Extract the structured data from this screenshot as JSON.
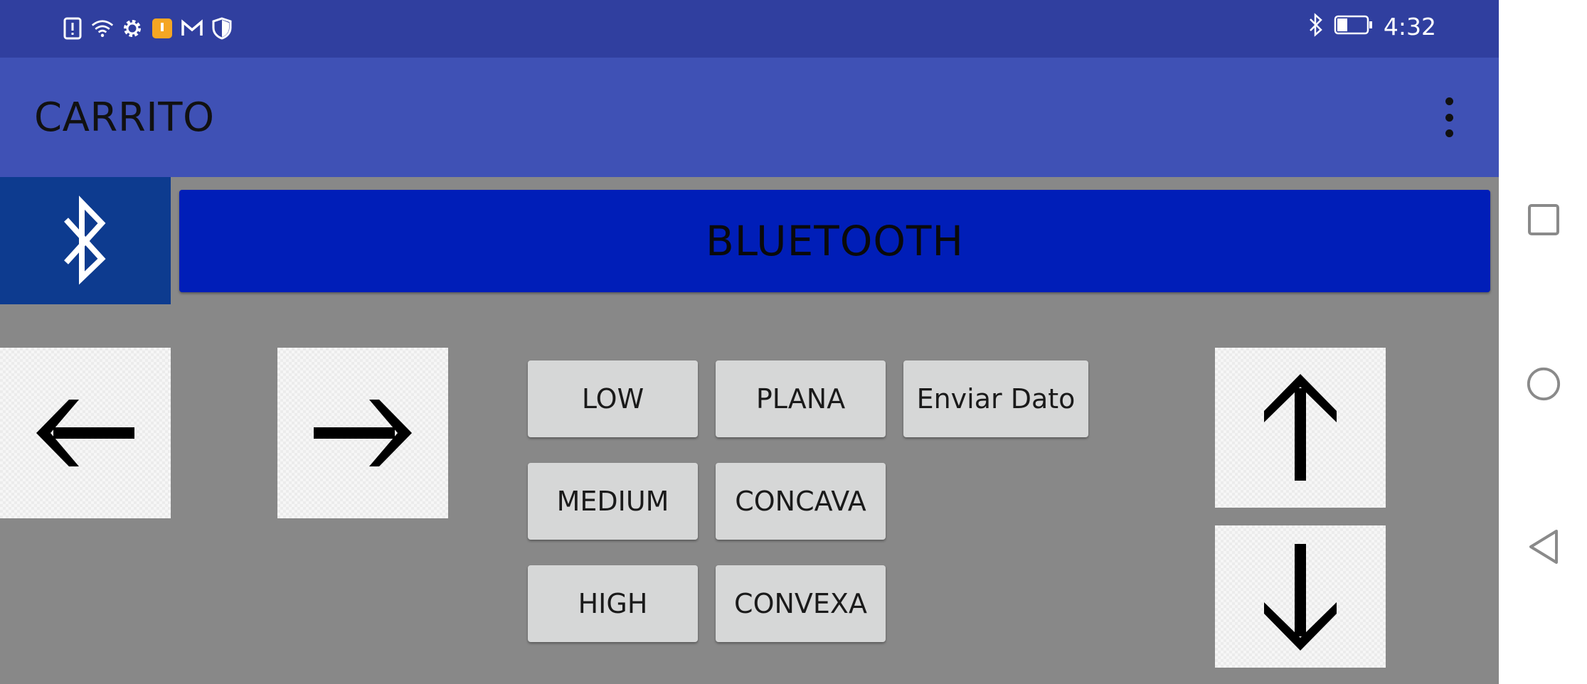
{
  "status_bar": {
    "time": "4:32",
    "left_icons": [
      "alert-card-icon",
      "wifi-icon",
      "settings-gear-icon",
      "notification-app-icon",
      "gmail-icon",
      "shield-icon"
    ],
    "right_icons": [
      "bluetooth-icon",
      "battery-icon"
    ],
    "battery_level": 0.35
  },
  "app_bar": {
    "title": "CARRITO",
    "overflow_icon": "more-vert-icon"
  },
  "main": {
    "bluetooth_icon": "bluetooth-icon",
    "bluetooth_button": "BLUETOOTH",
    "arrows": {
      "left": "arrow-left-icon",
      "right": "arrow-right-icon",
      "up": "arrow-up-icon",
      "down": "arrow-down-icon"
    },
    "buttons": {
      "low": "LOW",
      "plana": "PLANA",
      "enviar": "Enviar Dato",
      "medium": "MEDIUM",
      "concava": "CONCAVA",
      "high": "HIGH",
      "convexa": "CONVEXA"
    }
  },
  "nav_bar": {
    "recents": "square-recents-icon",
    "home": "circle-home-icon",
    "back": "triangle-back-icon"
  },
  "colors": {
    "status_bar": "#303f9f",
    "app_bar": "#3f51b5",
    "background": "#888888",
    "bluetooth_button": "#001eb8",
    "bluetooth_icon_bg": "#0d3b8f",
    "gray_button": "#d6d7d7"
  }
}
